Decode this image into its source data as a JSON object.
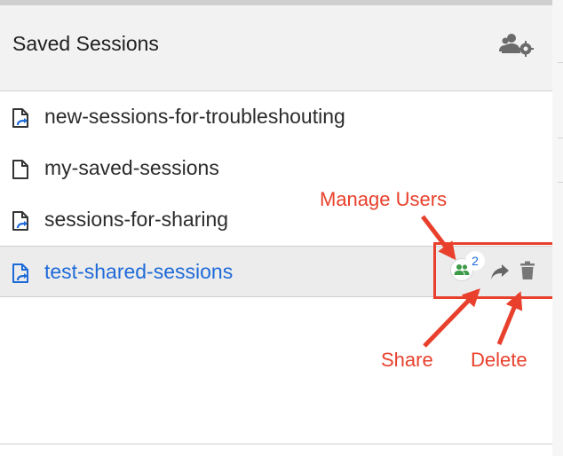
{
  "header": {
    "title": "Saved Sessions",
    "action_icon": "users-gear-icon"
  },
  "sessions": [
    {
      "name": "new-sessions-for-troubleshouting",
      "icon": "shared-file-icon",
      "selected": false
    },
    {
      "name": "my-saved-sessions",
      "icon": "file-icon",
      "selected": false
    },
    {
      "name": "sessions-for-sharing",
      "icon": "shared-file-icon",
      "selected": false
    },
    {
      "name": "test-shared-sessions",
      "icon": "shared-file-icon",
      "selected": true
    }
  ],
  "selected_actions": {
    "users_count": "2",
    "manage_users_icon": "users-icon",
    "share_icon": "share-arrow-icon",
    "delete_icon": "trash-icon"
  },
  "annotations": {
    "manage_users": "Manage Users",
    "share": "Share",
    "delete": "Delete"
  },
  "colors": {
    "selected_text": "#1e6ad8",
    "annotation": "#e8402c",
    "users_icon": "#3d9b47"
  }
}
